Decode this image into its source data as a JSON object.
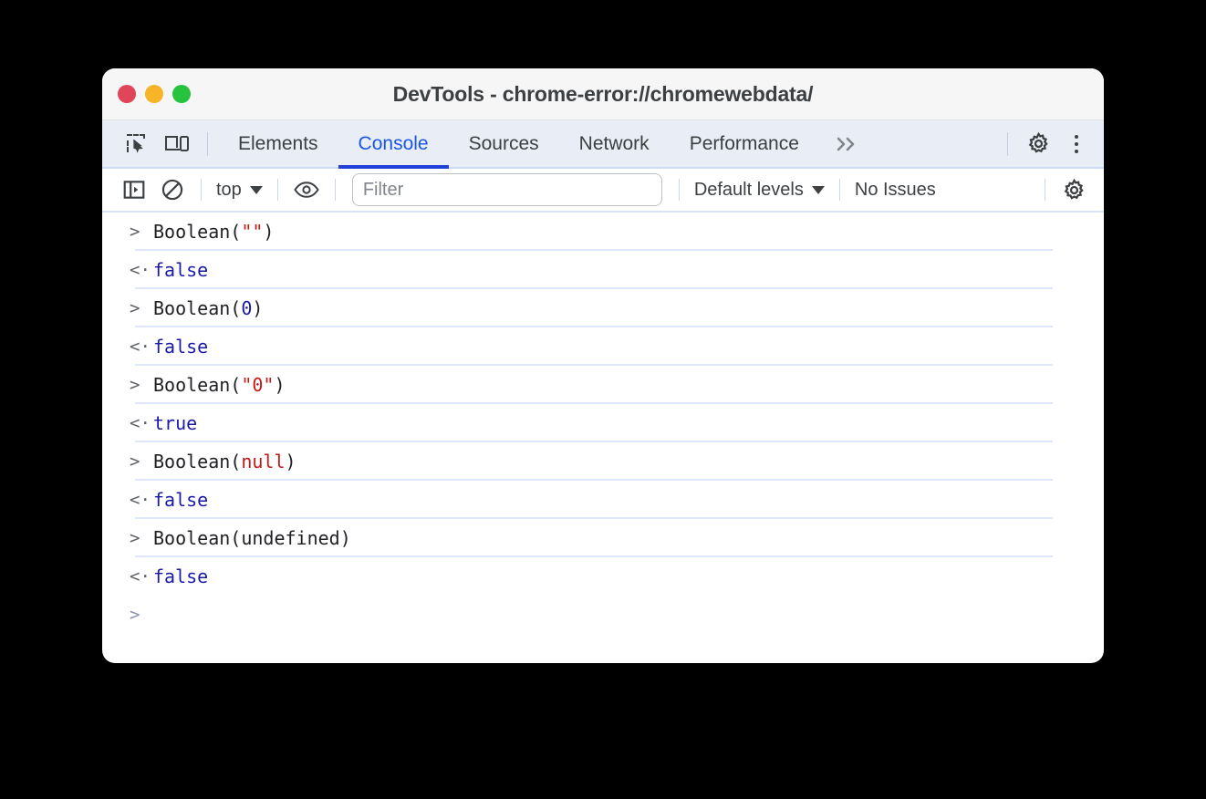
{
  "window": {
    "title": "DevTools - chrome-error://chromewebdata/",
    "traffic_lights": [
      {
        "name": "close",
        "color": "#e0455a"
      },
      {
        "name": "minimize",
        "color": "#f6b426"
      },
      {
        "name": "maximize",
        "color": "#26c33e"
      }
    ]
  },
  "tabbar": {
    "icons": [
      {
        "name": "inspect-element-icon",
        "label": "Inspect element"
      },
      {
        "name": "device-toolbar-icon",
        "label": "Toggle device toolbar"
      }
    ],
    "tabs": [
      {
        "label": "Elements",
        "active": false
      },
      {
        "label": "Console",
        "active": true
      },
      {
        "label": "Sources",
        "active": false
      },
      {
        "label": "Network",
        "active": false
      },
      {
        "label": "Performance",
        "active": false
      }
    ],
    "more_tabs_label": "»",
    "settings_label": "Settings",
    "menu_label": "Customize and control DevTools"
  },
  "console_toolbar": {
    "sidebar_toggle_label": "Show console sidebar",
    "clear_console_label": "Clear console",
    "context_selector": "top",
    "eye_label": "Create live expression",
    "filter_placeholder": "Filter",
    "filter_value": "",
    "levels_label": "Default levels",
    "issues_label": "No Issues",
    "settings_label": "Console settings"
  },
  "console": {
    "input_prompt": ">",
    "output_prompt": "<·",
    "entries": [
      {
        "kind": "input",
        "fn": "Boolean(",
        "arg": "\"\"",
        "arg_type": "string",
        "close": ")"
      },
      {
        "kind": "output",
        "value": "false"
      },
      {
        "kind": "input",
        "fn": "Boolean(",
        "arg": "0",
        "arg_type": "number",
        "close": ")"
      },
      {
        "kind": "output",
        "value": "false"
      },
      {
        "kind": "input",
        "fn": "Boolean(",
        "arg": "\"0\"",
        "arg_type": "string",
        "close": ")"
      },
      {
        "kind": "output",
        "value": "true"
      },
      {
        "kind": "input",
        "fn": "Boolean(",
        "arg": "null",
        "arg_type": "null",
        "close": ")"
      },
      {
        "kind": "output",
        "value": "false"
      },
      {
        "kind": "input",
        "fn": "Boolean(",
        "arg": "undefined",
        "arg_type": "plain",
        "close": ")"
      },
      {
        "kind": "output",
        "value": "false"
      }
    ],
    "empty_prompt": ">"
  },
  "colors": {
    "accent": "#1a56e8",
    "tab_underline": "#2040d8",
    "string": "#c41a16",
    "number": "#1a1aa6",
    "result": "#1a1aa6",
    "row_rule": "#dde6fa",
    "tabbar_bg": "#e9edf5",
    "page_bg": "#000000"
  }
}
